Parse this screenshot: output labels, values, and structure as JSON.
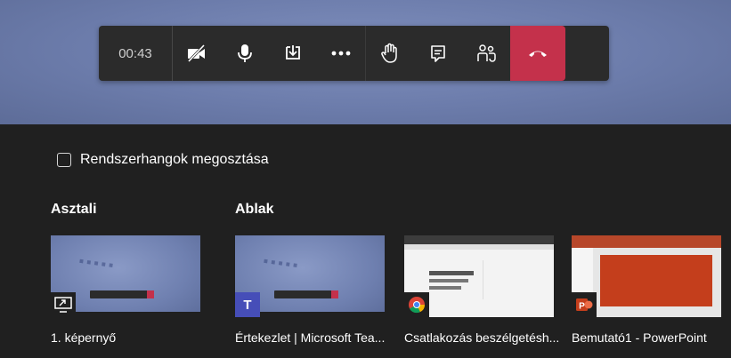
{
  "toolbar": {
    "timer": "00:43",
    "buttons": [
      {
        "icon": "camera-off-icon"
      },
      {
        "icon": "microphone-icon"
      },
      {
        "icon": "share-tray-icon"
      },
      {
        "icon": "more-options-icon"
      },
      {
        "icon": "raise-hand-icon"
      },
      {
        "icon": "chat-icon"
      },
      {
        "icon": "participants-icon"
      },
      {
        "icon": "hang-up-icon"
      }
    ],
    "hangup_color": "#c4314b"
  },
  "share_tray": {
    "system_audio_label": "Rendszerhangok megosztása",
    "system_audio_checked": false,
    "desktop_section_title": "Asztali",
    "window_section_title": "Ablak",
    "desktop_items": [
      {
        "label": "1. képernyő",
        "icon": "monitor-share-icon"
      }
    ],
    "window_items": [
      {
        "label": "Értekezlet | Microsoft Tea...",
        "icon": "teams-icon"
      },
      {
        "label": "Csatlakozás beszélgetésh...",
        "icon": "chrome-icon"
      },
      {
        "label": "Bemutató1 - PowerPoint",
        "icon": "powerpoint-icon"
      }
    ]
  }
}
